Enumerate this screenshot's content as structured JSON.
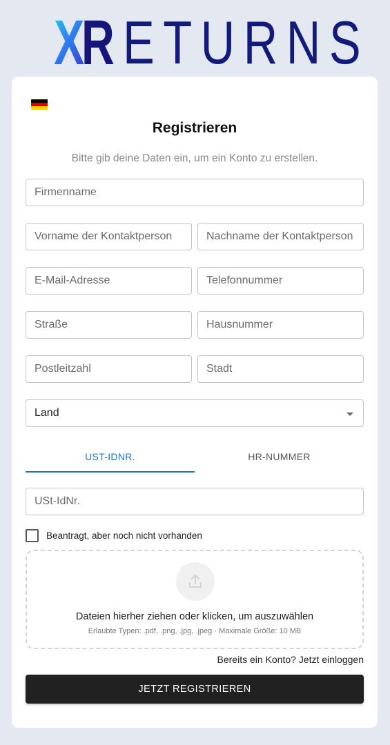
{
  "brand": {
    "logo_x": "X",
    "logo_r": "R",
    "logo_rest": "ETURNS"
  },
  "colors": {
    "background": "#e4e9f1",
    "brand_navy": "#121a7a",
    "accent": "#1e78c2",
    "button": "#212121",
    "flag": [
      "#000000",
      "#dd0000",
      "#ffce00"
    ]
  },
  "language_icon": "germany-flag-icon",
  "form": {
    "title": "Registrieren",
    "subtitle": "Bitte gib deine Daten ein, um ein Konto zu erstellen.",
    "fields": {
      "company": "Firmenname",
      "first_name": "Vorname der Kontaktperson",
      "last_name": "Nachname der Kontaktperson",
      "email": "E-Mail-Adresse",
      "phone": "Telefonnummer",
      "street": "Straße",
      "house_number": "Hausnummer",
      "postal_code": "Postleitzahl",
      "city": "Stadt",
      "country": "Land"
    },
    "tabs": [
      {
        "label": "UST-IDNR.",
        "active": true
      },
      {
        "label": "HR-NUMMER",
        "active": false
      }
    ],
    "vat_field": "USt-IdNr.",
    "checkbox_label": "Beantragt, aber noch nicht vorhanden",
    "checkbox_checked": false,
    "dropzone": {
      "icon": "upload-icon",
      "text": "Dateien hierher ziehen oder klicken, um auszuwählen",
      "hint": "Erlaubte Typen: .pdf, .png, .jpg, .jpeg · Maximale Größe: 10 MB"
    },
    "login_link": "Bereits ein Konto? Jetzt einloggen",
    "submit_label": "JETZT REGISTRIEREN"
  }
}
